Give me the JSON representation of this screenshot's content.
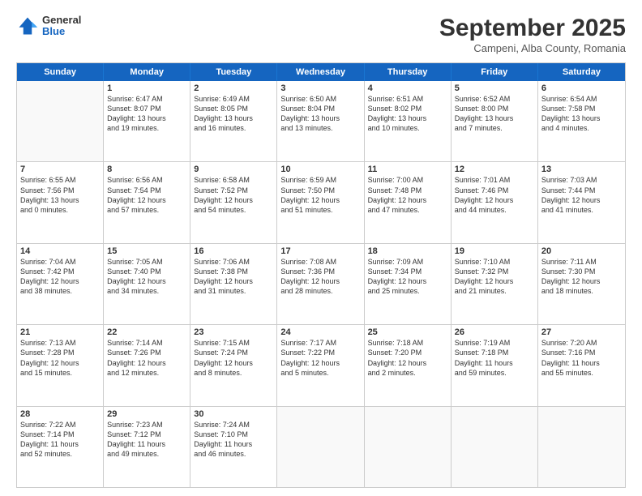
{
  "header": {
    "logo_general": "General",
    "logo_blue": "Blue",
    "month_title": "September 2025",
    "location": "Campeni, Alba County, Romania"
  },
  "weekdays": [
    "Sunday",
    "Monday",
    "Tuesday",
    "Wednesday",
    "Thursday",
    "Friday",
    "Saturday"
  ],
  "rows": [
    [
      {
        "day": "",
        "lines": []
      },
      {
        "day": "1",
        "lines": [
          "Sunrise: 6:47 AM",
          "Sunset: 8:07 PM",
          "Daylight: 13 hours",
          "and 19 minutes."
        ]
      },
      {
        "day": "2",
        "lines": [
          "Sunrise: 6:49 AM",
          "Sunset: 8:05 PM",
          "Daylight: 13 hours",
          "and 16 minutes."
        ]
      },
      {
        "day": "3",
        "lines": [
          "Sunrise: 6:50 AM",
          "Sunset: 8:04 PM",
          "Daylight: 13 hours",
          "and 13 minutes."
        ]
      },
      {
        "day": "4",
        "lines": [
          "Sunrise: 6:51 AM",
          "Sunset: 8:02 PM",
          "Daylight: 13 hours",
          "and 10 minutes."
        ]
      },
      {
        "day": "5",
        "lines": [
          "Sunrise: 6:52 AM",
          "Sunset: 8:00 PM",
          "Daylight: 13 hours",
          "and 7 minutes."
        ]
      },
      {
        "day": "6",
        "lines": [
          "Sunrise: 6:54 AM",
          "Sunset: 7:58 PM",
          "Daylight: 13 hours",
          "and 4 minutes."
        ]
      }
    ],
    [
      {
        "day": "7",
        "lines": [
          "Sunrise: 6:55 AM",
          "Sunset: 7:56 PM",
          "Daylight: 13 hours",
          "and 0 minutes."
        ]
      },
      {
        "day": "8",
        "lines": [
          "Sunrise: 6:56 AM",
          "Sunset: 7:54 PM",
          "Daylight: 12 hours",
          "and 57 minutes."
        ]
      },
      {
        "day": "9",
        "lines": [
          "Sunrise: 6:58 AM",
          "Sunset: 7:52 PM",
          "Daylight: 12 hours",
          "and 54 minutes."
        ]
      },
      {
        "day": "10",
        "lines": [
          "Sunrise: 6:59 AM",
          "Sunset: 7:50 PM",
          "Daylight: 12 hours",
          "and 51 minutes."
        ]
      },
      {
        "day": "11",
        "lines": [
          "Sunrise: 7:00 AM",
          "Sunset: 7:48 PM",
          "Daylight: 12 hours",
          "and 47 minutes."
        ]
      },
      {
        "day": "12",
        "lines": [
          "Sunrise: 7:01 AM",
          "Sunset: 7:46 PM",
          "Daylight: 12 hours",
          "and 44 minutes."
        ]
      },
      {
        "day": "13",
        "lines": [
          "Sunrise: 7:03 AM",
          "Sunset: 7:44 PM",
          "Daylight: 12 hours",
          "and 41 minutes."
        ]
      }
    ],
    [
      {
        "day": "14",
        "lines": [
          "Sunrise: 7:04 AM",
          "Sunset: 7:42 PM",
          "Daylight: 12 hours",
          "and 38 minutes."
        ]
      },
      {
        "day": "15",
        "lines": [
          "Sunrise: 7:05 AM",
          "Sunset: 7:40 PM",
          "Daylight: 12 hours",
          "and 34 minutes."
        ]
      },
      {
        "day": "16",
        "lines": [
          "Sunrise: 7:06 AM",
          "Sunset: 7:38 PM",
          "Daylight: 12 hours",
          "and 31 minutes."
        ]
      },
      {
        "day": "17",
        "lines": [
          "Sunrise: 7:08 AM",
          "Sunset: 7:36 PM",
          "Daylight: 12 hours",
          "and 28 minutes."
        ]
      },
      {
        "day": "18",
        "lines": [
          "Sunrise: 7:09 AM",
          "Sunset: 7:34 PM",
          "Daylight: 12 hours",
          "and 25 minutes."
        ]
      },
      {
        "day": "19",
        "lines": [
          "Sunrise: 7:10 AM",
          "Sunset: 7:32 PM",
          "Daylight: 12 hours",
          "and 21 minutes."
        ]
      },
      {
        "day": "20",
        "lines": [
          "Sunrise: 7:11 AM",
          "Sunset: 7:30 PM",
          "Daylight: 12 hours",
          "and 18 minutes."
        ]
      }
    ],
    [
      {
        "day": "21",
        "lines": [
          "Sunrise: 7:13 AM",
          "Sunset: 7:28 PM",
          "Daylight: 12 hours",
          "and 15 minutes."
        ]
      },
      {
        "day": "22",
        "lines": [
          "Sunrise: 7:14 AM",
          "Sunset: 7:26 PM",
          "Daylight: 12 hours",
          "and 12 minutes."
        ]
      },
      {
        "day": "23",
        "lines": [
          "Sunrise: 7:15 AM",
          "Sunset: 7:24 PM",
          "Daylight: 12 hours",
          "and 8 minutes."
        ]
      },
      {
        "day": "24",
        "lines": [
          "Sunrise: 7:17 AM",
          "Sunset: 7:22 PM",
          "Daylight: 12 hours",
          "and 5 minutes."
        ]
      },
      {
        "day": "25",
        "lines": [
          "Sunrise: 7:18 AM",
          "Sunset: 7:20 PM",
          "Daylight: 12 hours",
          "and 2 minutes."
        ]
      },
      {
        "day": "26",
        "lines": [
          "Sunrise: 7:19 AM",
          "Sunset: 7:18 PM",
          "Daylight: 11 hours",
          "and 59 minutes."
        ]
      },
      {
        "day": "27",
        "lines": [
          "Sunrise: 7:20 AM",
          "Sunset: 7:16 PM",
          "Daylight: 11 hours",
          "and 55 minutes."
        ]
      }
    ],
    [
      {
        "day": "28",
        "lines": [
          "Sunrise: 7:22 AM",
          "Sunset: 7:14 PM",
          "Daylight: 11 hours",
          "and 52 minutes."
        ]
      },
      {
        "day": "29",
        "lines": [
          "Sunrise: 7:23 AM",
          "Sunset: 7:12 PM",
          "Daylight: 11 hours",
          "and 49 minutes."
        ]
      },
      {
        "day": "30",
        "lines": [
          "Sunrise: 7:24 AM",
          "Sunset: 7:10 PM",
          "Daylight: 11 hours",
          "and 46 minutes."
        ]
      },
      {
        "day": "",
        "lines": []
      },
      {
        "day": "",
        "lines": []
      },
      {
        "day": "",
        "lines": []
      },
      {
        "day": "",
        "lines": []
      }
    ]
  ]
}
